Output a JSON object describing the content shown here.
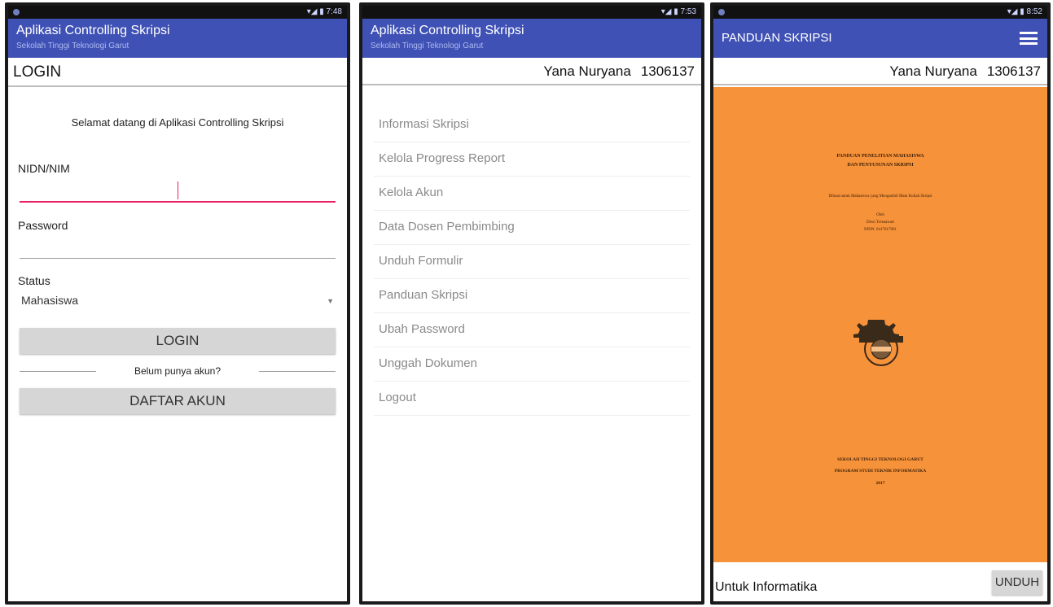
{
  "screen1": {
    "app_title": "Aplikasi Controlling Skripsi",
    "app_subtitle": "Sekolah Tinggi Teknologi Garut",
    "page_title": "LOGIN",
    "welcome": "Selamat datang di Aplikasi Controlling Skripsi",
    "nidn_label": "NIDN/NIM",
    "password_label": "Password",
    "status_label": "Status",
    "status_value": "Mahasiswa",
    "login_button": "LOGIN",
    "no_account_text": "Belum punya akun?",
    "register_button": "DAFTAR AKUN",
    "status_time": "7:48"
  },
  "screen2": {
    "app_title": "Aplikasi Controlling Skripsi",
    "app_subtitle": "Sekolah Tinggi Teknologi Garut",
    "user_name": "Yana Nuryana",
    "user_id": "1306137",
    "status_time": "7:53",
    "menu": [
      "Informasi Skripsi",
      "Kelola Progress Report",
      "Kelola Akun",
      "Data Dosen Pembimbing",
      "Unduh Formulir",
      "Panduan Skripsi",
      "Ubah Password",
      "Unggah Dokumen",
      "Logout"
    ]
  },
  "screen3": {
    "app_title": "PANDUAN SKRIPSI",
    "user_name": "Yana Nuryana",
    "user_id": "1306137",
    "status_time": "8:52",
    "doc_title_line1": "PANDUAN PENELITIAN MAHASISWA",
    "doc_title_line2": "DAN PENYUSUNAN SKRIPSI",
    "doc_purpose": "Dibuat untuk Mahasiswa yang Mengambil Mata Kuliah Skripsi",
    "doc_by": "Oleh",
    "doc_author": "Dewi Tresnawati",
    "doc_nidn": "NIDN. 0417017901",
    "doc_footer_line1": "SEKOLAH TINGGI TEKNOLOGI GARUT",
    "doc_footer_line2": "PROGRAM STUDI TEKNIK INFORMATIKA",
    "doc_year": "2017",
    "footer_text": "Untuk Informatika",
    "download_button": "UNDUH"
  },
  "colors": {
    "appbar": "#3f51b5",
    "accent": "#e91e63",
    "doc_cover": "#f6923a",
    "button_bg": "#d6d6d6"
  }
}
